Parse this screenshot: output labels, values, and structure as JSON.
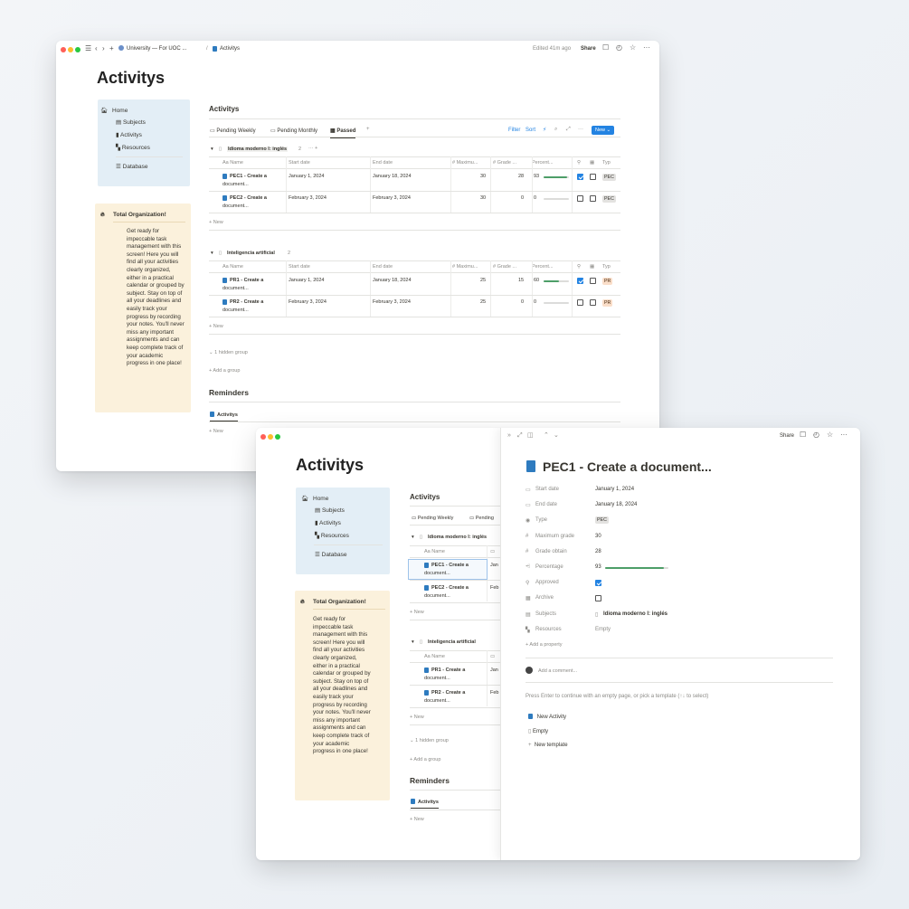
{
  "window1": {
    "breadcrumb_workspace": "University — For UOC ...",
    "breadcrumb_sep": "/",
    "breadcrumb_page": "Activitys",
    "edited": "Edited 41m ago",
    "share": "Share",
    "page_title": "Activitys",
    "sidebar": {
      "items": [
        "Home",
        "Subjects",
        "Activitys",
        "Resources",
        "Database"
      ]
    },
    "org": {
      "title": "Total Organization!",
      "body": "Get ready for\nimpeccable task\nmanagement with this\nscreen! Here you will\nfind all your activities\nclearly organized,\neither in a practical\ncalendar or grouped by\nsubject. Stay on top of\nall your deadlines and\neasily track your\nprogress by recording\nyour notes. You'll never\nmiss any important\nassignments and can\nkeep complete track of\nyour academic\nprogress in one place!"
    },
    "db_title": "Activitys",
    "views": [
      "Pending Weekly",
      "Pending Monthly",
      "Passed"
    ],
    "view_add": "+",
    "toolbar": {
      "filter": "Filter",
      "sort": "Sort",
      "new": "New"
    },
    "columns": [
      "Aa Name",
      "Start date",
      "End date",
      "# Maximu...",
      "# Grade ...",
      "Percent...",
      "Typ"
    ],
    "groups": [
      {
        "name": "Idioma moderno I: inglés",
        "count": "2",
        "extra": "···  +",
        "rows": [
          {
            "name": "PEC1 - Create a",
            "name2": "document...",
            "start": "January 1, 2024",
            "end": "January 18, 2024",
            "max": "30",
            "grade": "28",
            "pct": "93",
            "pct_fill": 0.93,
            "approved": true,
            "archive": false,
            "type": "PEC"
          },
          {
            "name": "PEC2 - Create a",
            "name2": "document...",
            "start": "February 3, 2024",
            "end": "February 3, 2024",
            "max": "30",
            "grade": "0",
            "pct": "0",
            "pct_fill": 0,
            "approved": false,
            "archive": false,
            "type": "PEC"
          }
        ]
      },
      {
        "name": "Inteligencia artificial",
        "count": "2",
        "extra": "",
        "rows": [
          {
            "name": "PR1 - Create a",
            "name2": "document...",
            "start": "January 1, 2024",
            "end": "January 18, 2024",
            "max": "25",
            "grade": "15",
            "pct": "60",
            "pct_fill": 0.6,
            "approved": true,
            "archive": false,
            "type": "PR"
          },
          {
            "name": "PR2 - Create a",
            "name2": "document...",
            "start": "February 3, 2024",
            "end": "February 3, 2024",
            "max": "25",
            "grade": "0",
            "pct": "0",
            "pct_fill": 0,
            "approved": false,
            "archive": false,
            "type": "PR"
          }
        ]
      }
    ],
    "new_row": "+ New",
    "hidden_group": "1 hidden group",
    "add_group": "+ Add a group",
    "reminders": "Reminders",
    "reminders_tab": "Activitys",
    "reminders_new": "+ New"
  },
  "window2": {
    "share": "Share",
    "page_title": "Activitys",
    "db_title": "Activitys",
    "views": [
      "Pending Weekly",
      "Pending"
    ],
    "groups": [
      {
        "name": "Idioma moderno I: inglés",
        "rows": [
          {
            "name": "PEC1 - Create a",
            "name2": "document...",
            "cut": "Jan"
          },
          {
            "name": "PEC2 - Create a",
            "name2": "document...",
            "cut": "Feb"
          }
        ]
      },
      {
        "name": "Inteligencia artificial",
        "rows": [
          {
            "name": "PR1 - Create a",
            "name2": "document...",
            "cut": "Jan"
          },
          {
            "name": "PR2 - Create a",
            "name2": "document...",
            "cut": "Feb"
          }
        ]
      }
    ],
    "col_name": "Aa Name",
    "new_row": "+ New",
    "hidden_group": "1 hidden group",
    "add_group": "+ Add a group",
    "reminders": "Reminders",
    "reminders_tab": "Activitys",
    "reminders_new": "+ New",
    "panel": {
      "title": "PEC1 - Create a document...",
      "props": [
        {
          "label": "Start date",
          "value": "January 1, 2024"
        },
        {
          "label": "End date",
          "value": "January 18, 2024"
        },
        {
          "label": "Type",
          "value": "PEC"
        },
        {
          "label": "Maximum grade",
          "value": "30"
        },
        {
          "label": "Grade obtain",
          "value": "28"
        },
        {
          "label": "Percentage",
          "value": "93"
        },
        {
          "label": "Approved",
          "value": ""
        },
        {
          "label": "Archive",
          "value": ""
        },
        {
          "label": "Subjects",
          "value": "Idioma moderno I: inglés"
        },
        {
          "label": "Resources",
          "value": "Empty"
        }
      ],
      "percentage_fill": 0.93,
      "add_property": "+ Add a property",
      "add_comment": "Add a comment...",
      "hint": "Press Enter to continue with an empty page, or pick a template (↑↓ to select)",
      "templates": [
        "New Activity",
        "Empty",
        "New template"
      ]
    }
  },
  "colors": {
    "accent": "#2383e2",
    "sidebar_bg": "#e3eef6",
    "org_bg": "#fbf1dc",
    "bar": "#4d9e68"
  }
}
